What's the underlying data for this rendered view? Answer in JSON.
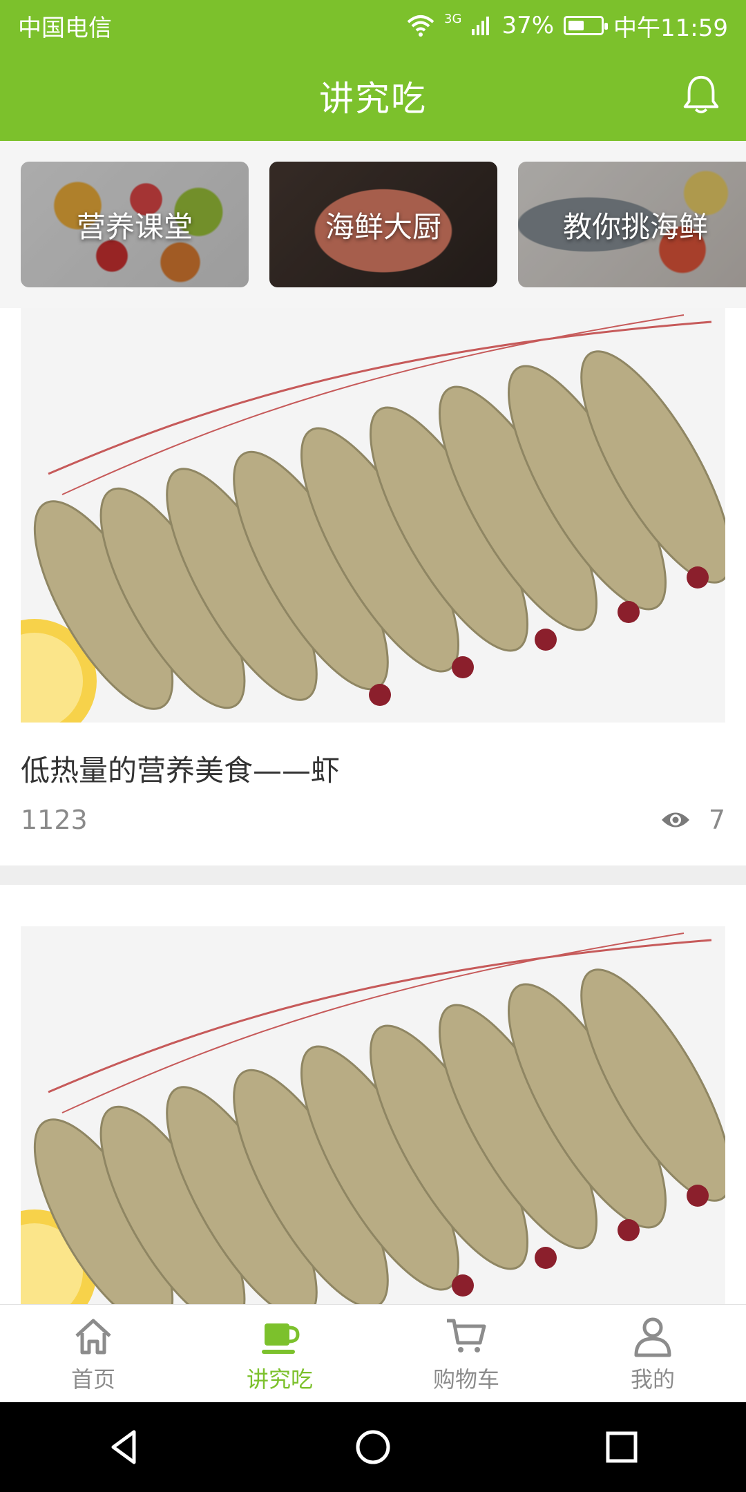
{
  "status": {
    "carrier": "中国电信",
    "network": "3G",
    "battery": "37%",
    "time": "中午11:59"
  },
  "header": {
    "title": "讲究吃",
    "icon": "bell-icon"
  },
  "categories": [
    {
      "label": "营养课堂"
    },
    {
      "label": "海鲜大厨"
    },
    {
      "label": "教你挑海鲜"
    }
  ],
  "articles": [
    {
      "title": "低热量的营养美食——虾",
      "count": "1123",
      "views": "7"
    },
    {
      "title": "",
      "count": "",
      "views": ""
    }
  ],
  "nav": {
    "items": [
      {
        "label": "首页",
        "icon": "home-icon"
      },
      {
        "label": "讲究吃",
        "icon": "cup-icon"
      },
      {
        "label": "购物车",
        "icon": "cart-icon"
      },
      {
        "label": "我的",
        "icon": "user-icon"
      }
    ],
    "active_index": 1
  },
  "colors": {
    "brand_green": "#7cc12c",
    "text_grey": "#8a8a8a"
  }
}
